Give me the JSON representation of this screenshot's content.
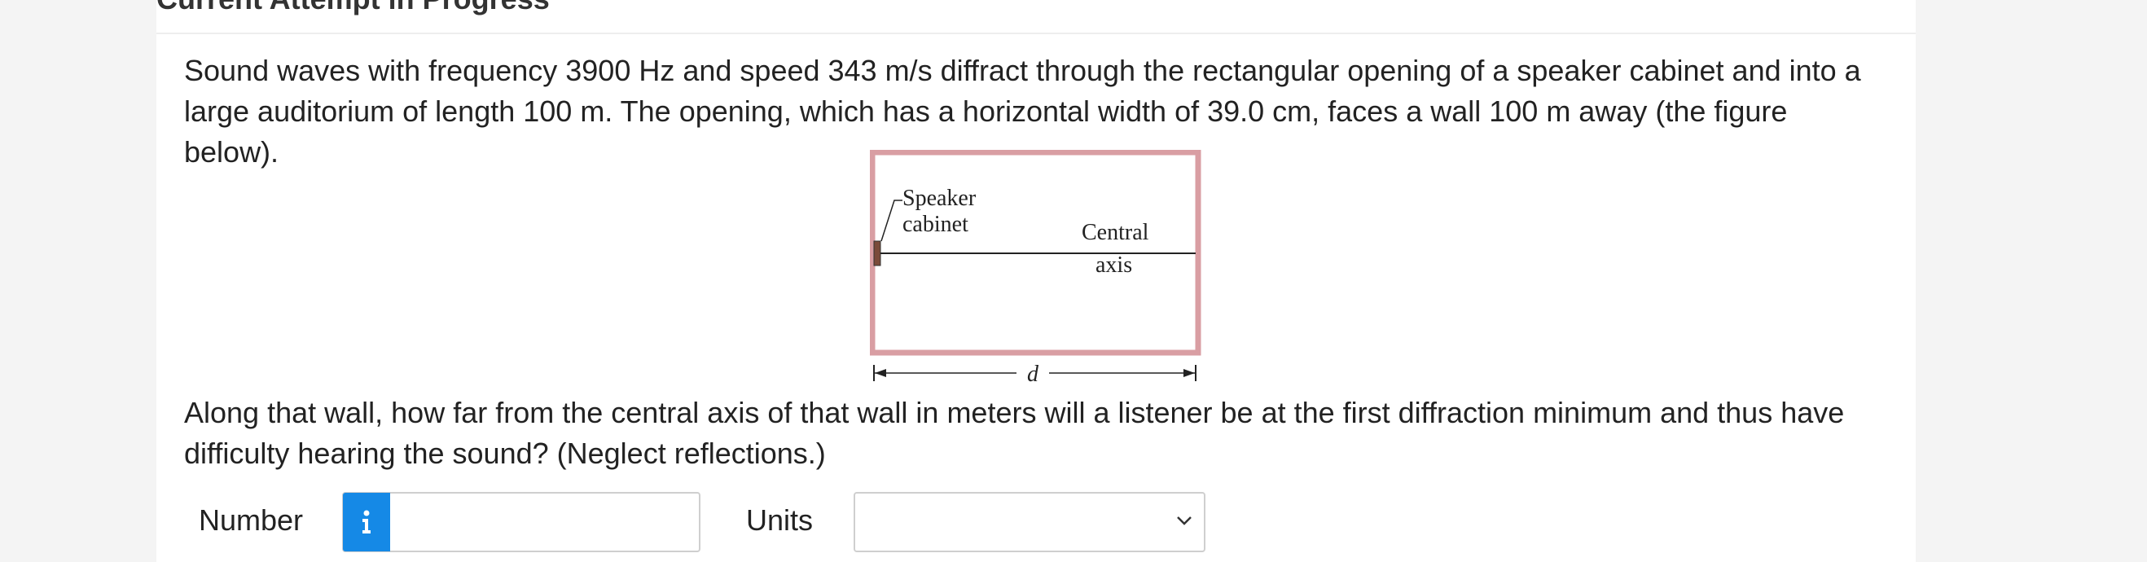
{
  "header": {
    "title": "Current Attempt in Progress"
  },
  "question": {
    "text": "Sound waves with frequency 3900 Hz and speed 343 m/s diffract through the rectangular opening of a speaker cabinet and into a large auditorium of length 100 m. The opening, which has a horizontal width of 39.0 cm, faces a wall 100 m away (the figure below).",
    "prompt": "Along that wall, how far from the central axis of that wall in meters will a listener be at the first diffraction minimum and thus have difficulty hearing the sound? (Neglect reflections.)"
  },
  "figure": {
    "speaker_label_line1": "Speaker",
    "speaker_label_line2": "cabinet",
    "axis_label_line1": "Central",
    "axis_label_line2": "axis",
    "distance_label": "d",
    "colors": {
      "wall": "#d99ea3",
      "cabinet": "#7a4b3a",
      "line": "#222222"
    }
  },
  "answer": {
    "number_label": "Number",
    "number_value": "",
    "info_icon": "info-icon",
    "units_label": "Units",
    "units_selected": "",
    "accent": "#1589e6"
  }
}
